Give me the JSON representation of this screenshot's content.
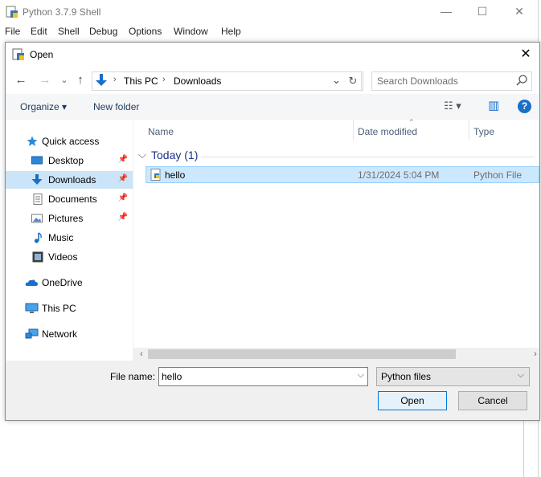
{
  "shell": {
    "title": "Python 3.7.9 Shell",
    "controls": {
      "minimize": "—",
      "maximize": "☐",
      "close": "✕"
    },
    "menu": [
      "File",
      "Edit",
      "Shell",
      "Debug",
      "Options",
      "Window",
      "Help"
    ]
  },
  "dialog": {
    "title": "Open",
    "close": "✕",
    "nav": {
      "back": "←",
      "forward": "→",
      "up": "↑",
      "dropdown": "⌄",
      "refresh": "↻"
    },
    "breadcrumb": [
      "This PC",
      "Downloads"
    ],
    "breadcrumb_sep": "›",
    "search": {
      "placeholder": "Search Downloads"
    },
    "toolbar": {
      "organize": "Organize ▾",
      "new_folder": "New folder",
      "view_options": "☷ ▾",
      "preview_pane": "▥",
      "help": "?"
    },
    "sidebar": {
      "items": [
        {
          "label": "Quick access",
          "icon": "star-icon",
          "pinned": false,
          "selected": false
        },
        {
          "label": "Desktop",
          "icon": "desktop-icon",
          "pinned": true,
          "selected": false
        },
        {
          "label": "Downloads",
          "icon": "download-icon",
          "pinned": true,
          "selected": true
        },
        {
          "label": "Documents",
          "icon": "document-icon",
          "pinned": true,
          "selected": false
        },
        {
          "label": "Pictures",
          "icon": "picture-icon",
          "pinned": true,
          "selected": false
        },
        {
          "label": "Music",
          "icon": "music-icon",
          "pinned": false,
          "selected": false
        },
        {
          "label": "Videos",
          "icon": "video-icon",
          "pinned": false,
          "selected": false
        },
        {
          "label": "OneDrive",
          "icon": "cloud-icon",
          "pinned": false,
          "selected": false
        },
        {
          "label": "This PC",
          "icon": "computer-icon",
          "pinned": false,
          "selected": false
        },
        {
          "label": "Network",
          "icon": "network-icon",
          "pinned": false,
          "selected": false
        }
      ],
      "pin_glyph": "📌"
    },
    "columns": {
      "name": "Name",
      "date": "Date modified",
      "type": "Type",
      "sort_glyph": "⌃"
    },
    "group": {
      "label": "Today (1)",
      "toggle": "⌵"
    },
    "files": [
      {
        "name": "hello",
        "date": "1/31/2024 5:04 PM",
        "type": "Python File"
      }
    ],
    "scroll": {
      "left": "‹",
      "right": "›"
    },
    "file_name": {
      "label": "File name:",
      "value": "hello",
      "dropdown": "⌵"
    },
    "file_type": {
      "value": "Python files",
      "dropdown": "⌵"
    },
    "buttons": {
      "open": "Open",
      "cancel": "Cancel"
    }
  },
  "colors": {
    "accent": "#0078d7",
    "selection": "#cce8ff",
    "nav_selection": "#cce4f7",
    "folder_blue": "#1a6fc7"
  }
}
